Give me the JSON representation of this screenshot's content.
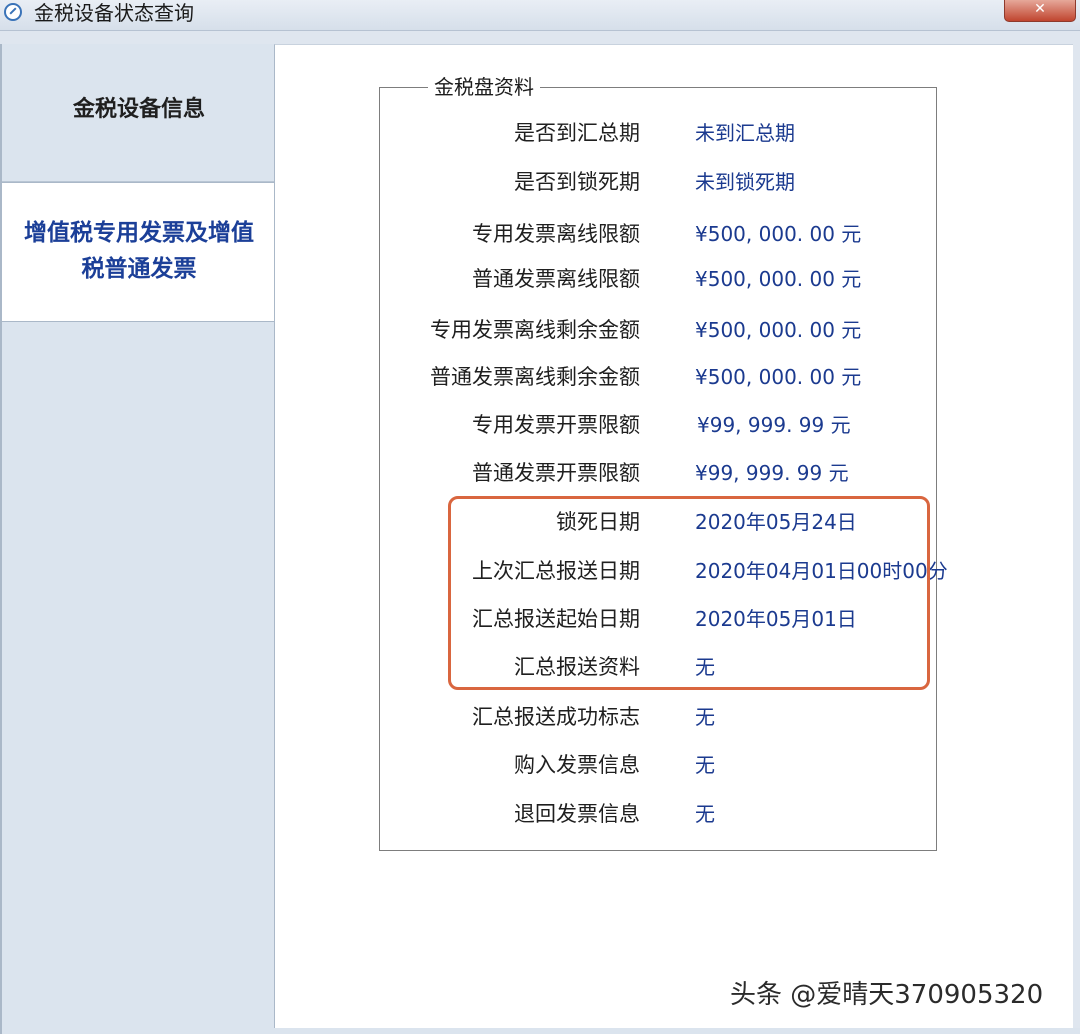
{
  "window": {
    "title": "金税设备状态查询",
    "close_label": "✕"
  },
  "sidebar": {
    "items": [
      {
        "label": "金税设备信息"
      },
      {
        "label": "增值税专用发票及增值税普通发票"
      }
    ]
  },
  "group": {
    "legend": "金税盘资料",
    "rows": [
      {
        "label": "是否到汇总期",
        "value": "未到汇总期"
      },
      {
        "label": "是否到锁死期",
        "value": "未到锁死期"
      },
      {
        "label": "专用发票离线限额",
        "value": "¥500, 000. 00 元"
      },
      {
        "label": "普通发票离线限额",
        "value": "¥500, 000. 00 元"
      },
      {
        "label": "专用发票离线剩余金额",
        "value": "¥500, 000. 00 元"
      },
      {
        "label": "普通发票离线剩余金额",
        "value": "¥500, 000. 00 元"
      },
      {
        "label": "专用发票开票限额",
        "value": "¥99, 999. 99 元"
      },
      {
        "label": "普通发票开票限额",
        "value": "¥99, 999. 99 元"
      },
      {
        "label": "锁死日期",
        "value": "2020年05月24日"
      },
      {
        "label": "上次汇总报送日期",
        "value": "2020年04月01日00时00分"
      },
      {
        "label": "汇总报送起始日期",
        "value": "2020年05月01日"
      },
      {
        "label": "汇总报送资料",
        "value": "无"
      },
      {
        "label": "汇总报送成功标志",
        "value": "无"
      },
      {
        "label": "购入发票信息",
        "value": "无"
      },
      {
        "label": "退回发票信息",
        "value": "无"
      }
    ]
  },
  "watermark": "头条 @爱晴天370905320",
  "colors": {
    "value_text": "#1b3a8f",
    "active_tab_text": "#1b3f98",
    "highlight_border": "#d9663f"
  }
}
